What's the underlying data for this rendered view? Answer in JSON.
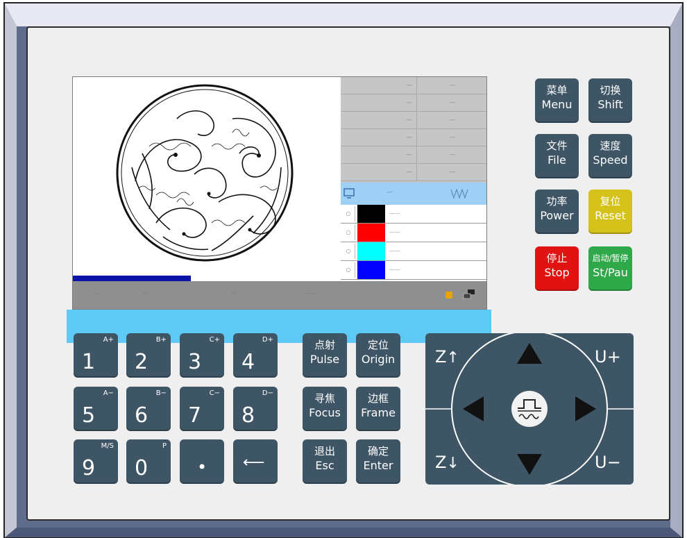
{
  "screen": {
    "progress_fraction": 0.44,
    "params": [
      {
        "k": "—",
        "v": "—"
      },
      {
        "k": "—",
        "v": "—"
      },
      {
        "k": "—",
        "v": "—"
      },
      {
        "k": "—",
        "v": "—"
      },
      {
        "k": "—",
        "v": "—"
      },
      {
        "k": "—",
        "v": "—"
      }
    ],
    "layers_header": {
      "label": "—"
    },
    "layers": [
      {
        "color": "#000000",
        "label": "——"
      },
      {
        "color": "#ff0000",
        "label": "——"
      },
      {
        "color": "#00ffff",
        "label": "——"
      },
      {
        "color": "#0000ff",
        "label": "——"
      }
    ],
    "status": [
      "—",
      "—",
      "—",
      "——"
    ]
  },
  "side_buttons": {
    "menu": {
      "cn": "菜单",
      "en": "Menu"
    },
    "shift": {
      "cn": "切换",
      "en": "Shift"
    },
    "file": {
      "cn": "文件",
      "en": "File"
    },
    "speed": {
      "cn": "速度",
      "en": "Speed"
    },
    "power": {
      "cn": "功率",
      "en": "Power"
    },
    "reset": {
      "cn": "复位",
      "en": "Reset"
    },
    "stop": {
      "cn": "停止",
      "en": "Stop"
    },
    "start_pause": {
      "cn": "启动/暂停",
      "en": "St/Pau"
    }
  },
  "numpad": [
    {
      "main": "1",
      "sup": "A+"
    },
    {
      "main": "2",
      "sup": "B+"
    },
    {
      "main": "3",
      "sup": "C+"
    },
    {
      "main": "4",
      "sup": "D+"
    },
    {
      "main": "5",
      "sup": "A−"
    },
    {
      "main": "6",
      "sup": "B−"
    },
    {
      "main": "7",
      "sup": "C−"
    },
    {
      "main": "8",
      "sup": "D−"
    },
    {
      "main": "9",
      "sup": "M/S"
    },
    {
      "main": "0",
      "sup": "P"
    },
    {
      "main": "•",
      "sup": ""
    },
    {
      "main": "⟵",
      "sup": ""
    }
  ],
  "func_buttons": {
    "pulse": {
      "cn": "点射",
      "en": "Pulse"
    },
    "origin": {
      "cn": "定位",
      "en": "Origin"
    },
    "focus": {
      "cn": "寻焦",
      "en": "Focus"
    },
    "frame": {
      "cn": "边框",
      "en": "Frame"
    },
    "esc": {
      "cn": "退出",
      "en": "Esc"
    },
    "enter": {
      "cn": "确定",
      "en": "Enter"
    }
  },
  "dpad": {
    "z_up": "Z",
    "u_plus": "U+",
    "z_down": "Z",
    "u_minus": "U−"
  },
  "colors": {
    "button": "#3e5566",
    "reset": "#d4c21a",
    "stop": "#e01212",
    "start": "#2fa84a",
    "cyan_bar": "#5ec9f5"
  }
}
